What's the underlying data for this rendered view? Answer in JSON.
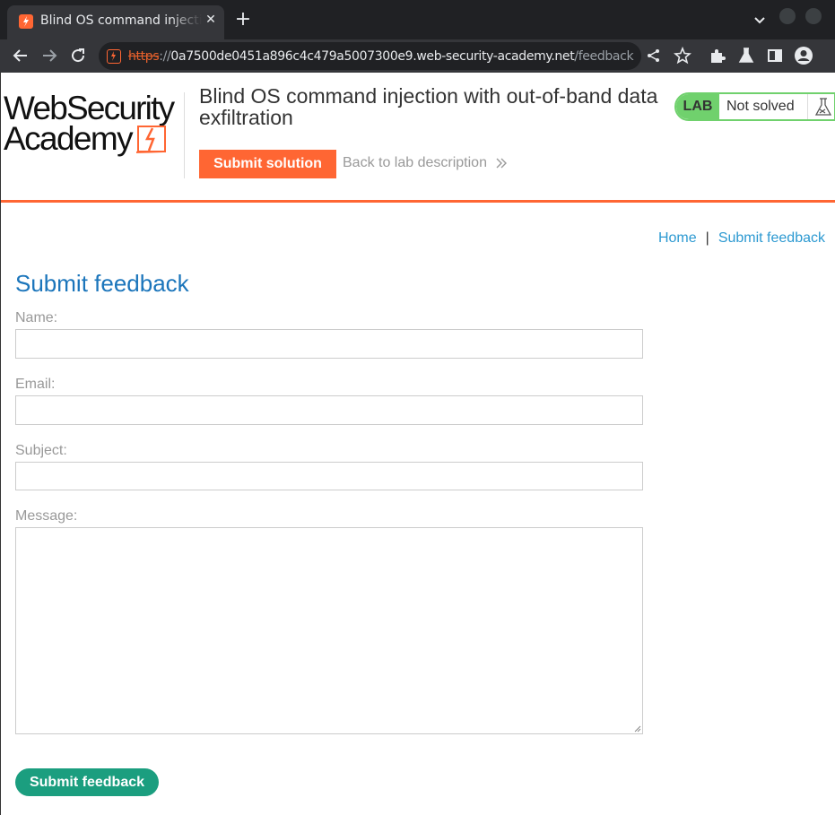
{
  "browser": {
    "tab_title": "Blind OS command injection with out-of-band data exfiltration",
    "new_tab_symbol": "+",
    "close_symbol": "✕",
    "url": {
      "scheme": "https",
      "separator": "://",
      "host": "0a7500de0451a896c4c479a5007300e9.web-security-academy.net",
      "path": "/feedback"
    },
    "colors": {
      "chrome_dark": "#202124",
      "chrome_tab": "#35363a",
      "accent": "#ff6633"
    }
  },
  "header": {
    "logo_line1": "WebSecurity",
    "logo_line2": "Academy",
    "lab_title": "Blind OS command injection with out-of-band data exfiltration",
    "submit_solution_label": "Submit solution",
    "back_link_label": "Back to lab description",
    "badge": {
      "tag": "LAB",
      "status": "Not solved",
      "color": "#70d16d"
    }
  },
  "breadcrumbs": {
    "home": "Home",
    "separator": "|",
    "current": "Submit feedback"
  },
  "form": {
    "title": "Submit feedback",
    "fields": [
      {
        "label": "Name:",
        "value": ""
      },
      {
        "label": "Email:",
        "value": ""
      },
      {
        "label": "Subject:",
        "value": ""
      },
      {
        "label": "Message:",
        "value": ""
      }
    ],
    "submit_label": "Submit feedback",
    "submit_color": "#1b9e7f"
  }
}
